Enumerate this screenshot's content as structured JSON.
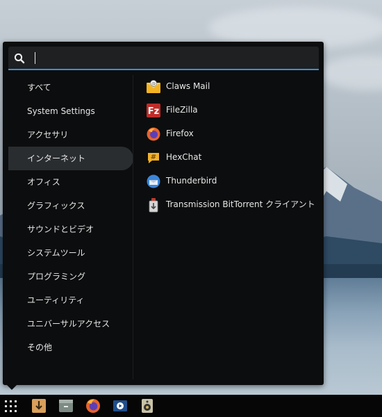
{
  "search": {
    "placeholder": "",
    "value": ""
  },
  "categories": [
    {
      "label": "すべて",
      "active": false
    },
    {
      "label": "System Settings",
      "active": false
    },
    {
      "label": "アクセサリ",
      "active": false
    },
    {
      "label": "インターネット",
      "active": true
    },
    {
      "label": "オフィス",
      "active": false
    },
    {
      "label": "グラフィックス",
      "active": false
    },
    {
      "label": "サウンドとビデオ",
      "active": false
    },
    {
      "label": "システムツール",
      "active": false
    },
    {
      "label": "プログラミング",
      "active": false
    },
    {
      "label": "ユーティリティ",
      "active": false
    },
    {
      "label": "ユニバーサルアクセス",
      "active": false
    },
    {
      "label": "その他",
      "active": false
    }
  ],
  "apps": [
    {
      "label": "Claws Mail",
      "icon": "claws-mail-icon"
    },
    {
      "label": "FileZilla",
      "icon": "filezilla-icon"
    },
    {
      "label": "Firefox",
      "icon": "firefox-icon"
    },
    {
      "label": "HexChat",
      "icon": "hexchat-icon"
    },
    {
      "label": "Thunderbird",
      "icon": "thunderbird-icon"
    },
    {
      "label": "Transmission BitTorrent クライアント",
      "icon": "transmission-icon"
    }
  ],
  "taskbar": [
    {
      "icon": "app-grid-icon"
    },
    {
      "icon": "downloader-icon"
    },
    {
      "icon": "file-manager-icon"
    },
    {
      "icon": "firefox-icon"
    },
    {
      "icon": "media-player-icon"
    },
    {
      "icon": "speaker-icon"
    }
  ],
  "colors": {
    "accent": "#3d8fd8",
    "menu_bg": "#0c0d0e",
    "active_bg": "#2a2d30"
  }
}
